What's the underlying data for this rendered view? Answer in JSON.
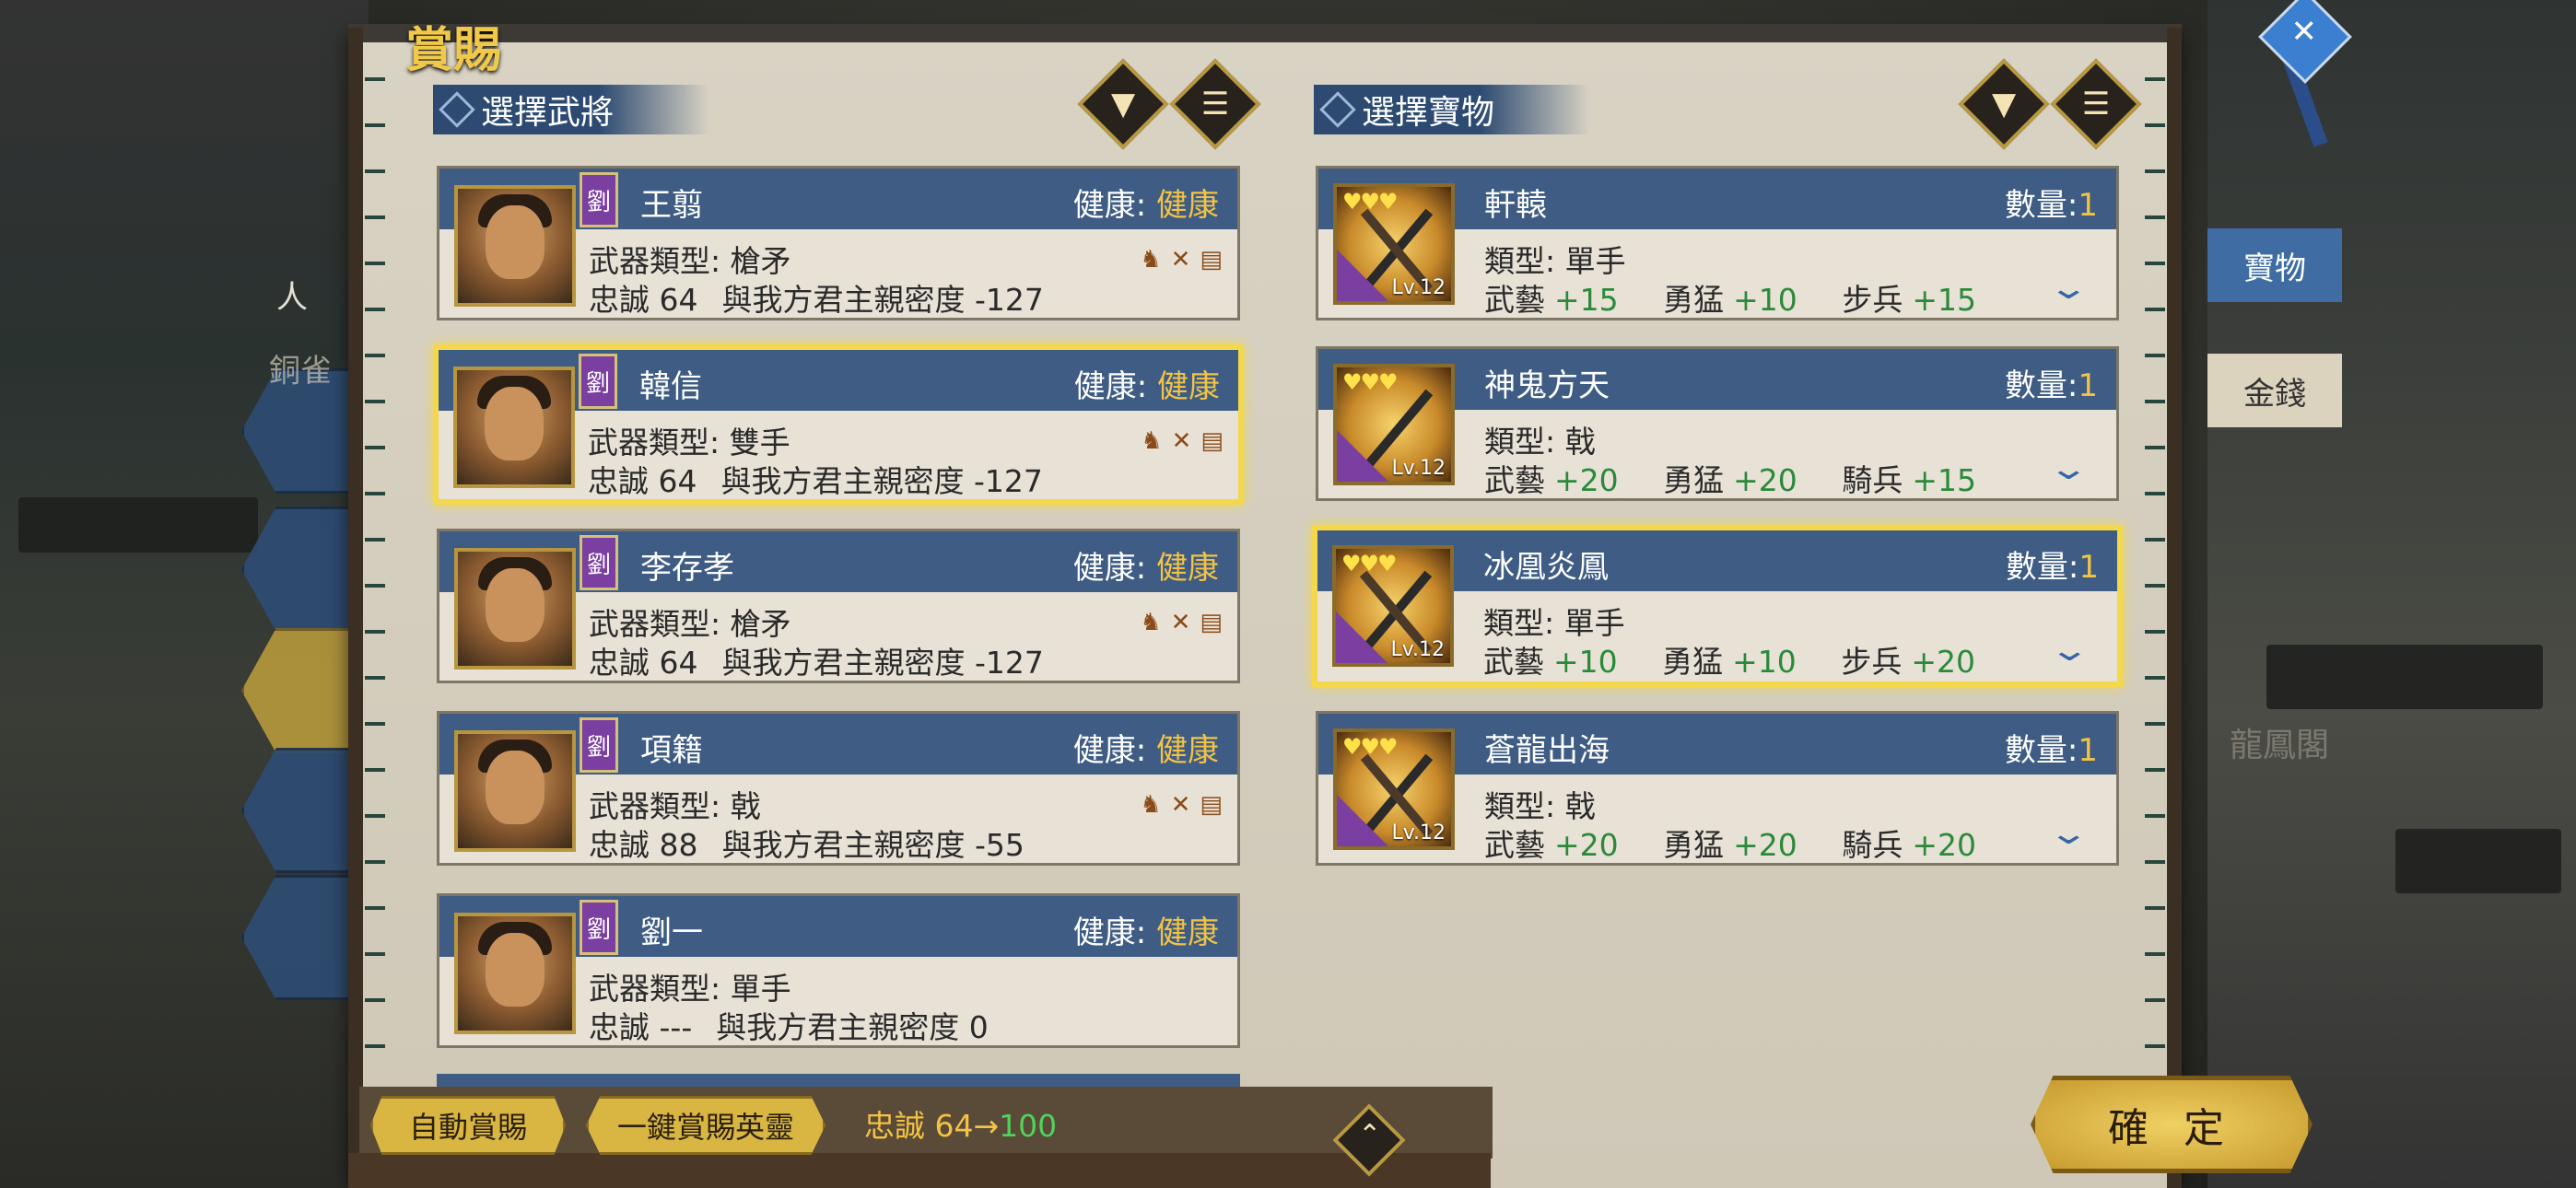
{
  "title": "賞賜",
  "background": {
    "side_labels": [
      "人",
      "銅雀"
    ],
    "right_label": "龍鳳閣"
  },
  "generals_section": {
    "header": "選擇武將",
    "filter_icon": "filter-icon",
    "list_icon": "list-icon",
    "health_label": "健康:",
    "generals": [
      {
        "faction": "劉",
        "name": "王翦",
        "health": "健康",
        "weapon_label": "武器類型:",
        "weapon": "槍矛",
        "loyalty_label": "忠誠",
        "loyalty": "64",
        "intimacy_label": "與我方君主親密度",
        "intimacy": "-127",
        "selected": false,
        "icons": true
      },
      {
        "faction": "劉",
        "name": "韓信",
        "health": "健康",
        "weapon_label": "武器類型:",
        "weapon": "雙手",
        "loyalty_label": "忠誠",
        "loyalty": "64",
        "intimacy_label": "與我方君主親密度",
        "intimacy": "-127",
        "selected": true,
        "icons": true
      },
      {
        "faction": "劉",
        "name": "李存孝",
        "health": "健康",
        "weapon_label": "武器類型:",
        "weapon": "槍矛",
        "loyalty_label": "忠誠",
        "loyalty": "64",
        "intimacy_label": "與我方君主親密度",
        "intimacy": "-127",
        "selected": false,
        "icons": true
      },
      {
        "faction": "劉",
        "name": "項籍",
        "health": "健康",
        "weapon_label": "武器類型:",
        "weapon": "戟",
        "loyalty_label": "忠誠",
        "loyalty": "88",
        "intimacy_label": "與我方君主親密度",
        "intimacy": "-55",
        "selected": false,
        "icons": true
      },
      {
        "faction": "劉",
        "name": "劉一",
        "health": "健康",
        "weapon_label": "武器類型:",
        "weapon": "單手",
        "loyalty_label": "忠誠",
        "loyalty": "---",
        "intimacy_label": "與我方君主親密度",
        "intimacy": "0",
        "selected": false,
        "icons": false
      }
    ]
  },
  "items_section": {
    "header": "選擇寶物",
    "filter_icon": "filter-icon",
    "list_icon": "list-icon",
    "qty_label": "數量:",
    "type_label": "類型:",
    "items": [
      {
        "name": "軒轅",
        "qty": "1",
        "type": "單手",
        "level": "Lv.12",
        "stats": [
          {
            "k": "武藝",
            "v": "+15"
          },
          {
            "k": "勇猛",
            "v": "+10"
          },
          {
            "k": "步兵",
            "v": "+15"
          }
        ],
        "selected": false
      },
      {
        "name": "神鬼方天",
        "qty": "1",
        "type": "戟",
        "level": "Lv.12",
        "stats": [
          {
            "k": "武藝",
            "v": "+20"
          },
          {
            "k": "勇猛",
            "v": "+20"
          },
          {
            "k": "騎兵",
            "v": "+15"
          }
        ],
        "selected": false
      },
      {
        "name": "冰凰炎鳳",
        "qty": "1",
        "type": "單手",
        "level": "Lv.12",
        "stats": [
          {
            "k": "武藝",
            "v": "+10"
          },
          {
            "k": "勇猛",
            "v": "+10"
          },
          {
            "k": "步兵",
            "v": "+20"
          }
        ],
        "selected": true
      },
      {
        "name": "蒼龍出海",
        "qty": "1",
        "type": "戟",
        "level": "Lv.12",
        "stats": [
          {
            "k": "武藝",
            "v": "+20"
          },
          {
            "k": "勇猛",
            "v": "+20"
          },
          {
            "k": "騎兵",
            "v": "+20"
          }
        ],
        "selected": false
      }
    ]
  },
  "right_tabs": {
    "treasure": "寶物",
    "money": "金錢"
  },
  "bottom": {
    "auto_reward": "自動賞賜",
    "one_click_reward": "一鍵賞賜英靈",
    "loyalty_text": "忠誠 64→",
    "loyalty_new": "100",
    "confirm": "確 定"
  },
  "colors": {
    "accent_gold": "#f2c344",
    "band_blue": "#3e5c84",
    "stat_green": "#2a8a3a",
    "selection": "#f3d84c"
  }
}
